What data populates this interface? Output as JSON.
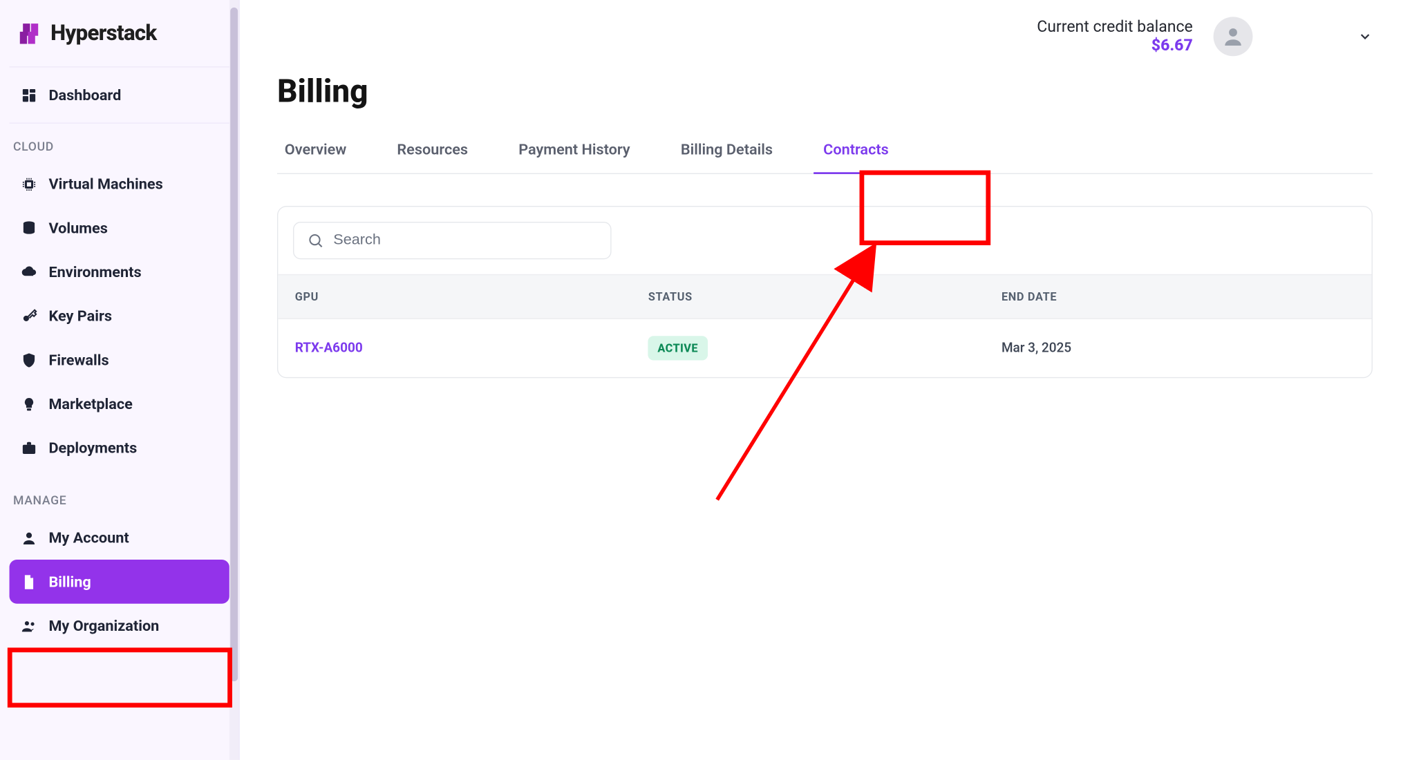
{
  "brand": {
    "name": "Hyperstack"
  },
  "sidebar": {
    "top_item": {
      "label": "Dashboard"
    },
    "sections": [
      {
        "label": "CLOUD",
        "items": [
          {
            "label": "Virtual Machines"
          },
          {
            "label": "Volumes"
          },
          {
            "label": "Environments"
          },
          {
            "label": "Key Pairs"
          },
          {
            "label": "Firewalls"
          },
          {
            "label": "Marketplace"
          },
          {
            "label": "Deployments"
          }
        ]
      },
      {
        "label": "MANAGE",
        "items": [
          {
            "label": "My Account"
          },
          {
            "label": "Billing"
          },
          {
            "label": "My Organization"
          }
        ]
      }
    ]
  },
  "header": {
    "balance_label": "Current credit balance",
    "balance_value": "$6.67"
  },
  "billing": {
    "title": "Billing",
    "tabs": [
      {
        "label": "Overview"
      },
      {
        "label": "Resources"
      },
      {
        "label": "Payment History"
      },
      {
        "label": "Billing Details"
      },
      {
        "label": "Contracts",
        "active": true
      }
    ],
    "search": {
      "placeholder": "Search"
    },
    "columns": {
      "gpu": "GPU",
      "status": "STATUS",
      "end_date": "END DATE"
    },
    "rows": [
      {
        "gpu": "RTX-A6000",
        "status": "ACTIVE",
        "end_date": "Mar 3, 2025"
      }
    ]
  },
  "annotations": {
    "highlight_tab": "Contracts",
    "highlight_nav": "Billing",
    "arrow_to_tab": true
  },
  "colors": {
    "accent": "#7c3aed",
    "active_nav": "#9333ea",
    "status_bg": "#d9f6e9",
    "status_fg": "#0e8a57",
    "annotation": "#ff0000"
  }
}
